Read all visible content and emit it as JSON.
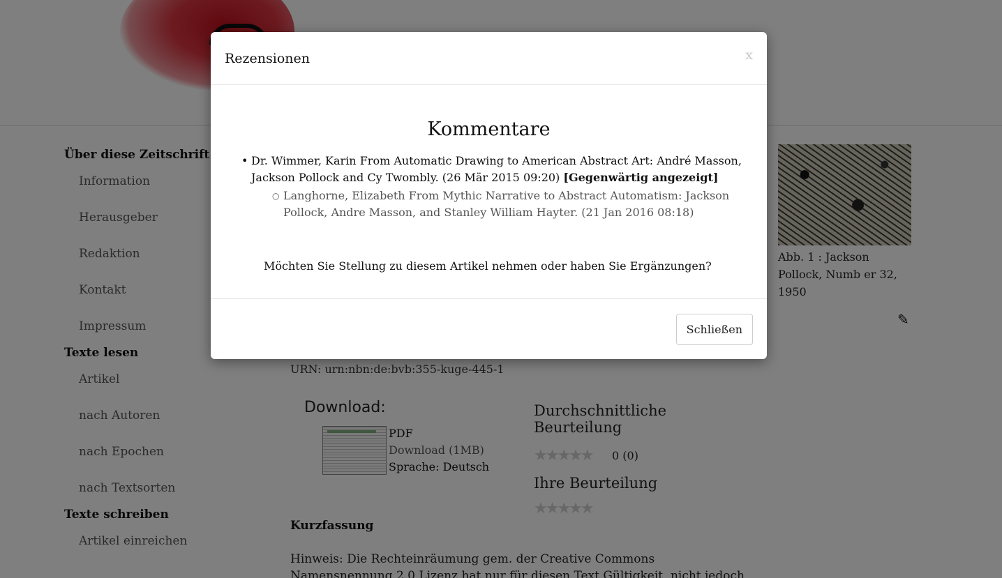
{
  "sidebar": {
    "sections": [
      {
        "heading": "Über diese Zeitschrift",
        "items": [
          "Information",
          "Herausgeber",
          "Redaktion",
          "Kontakt",
          "Impressum"
        ]
      },
      {
        "heading": "Texte lesen",
        "items": [
          "Artikel",
          "nach Autoren",
          "nach Epochen",
          "nach Textsorten"
        ]
      },
      {
        "heading": "Texte schreiben",
        "items": [
          "Artikel einreichen"
        ]
      }
    ]
  },
  "figure": {
    "caption": "Abb. 1 : Jackson Pollock, Numb er 32, 1950",
    "edit_icon": "pencil-icon"
  },
  "article": {
    "urn": "URN: urn:nbn:de:bvb:355-kuge-445-1",
    "download_heading": "Download:",
    "pdf_label": "PDF",
    "pdf_link": "Download (1MB)",
    "pdf_language": "Sprache: Deutsch",
    "rating_avg_heading": "Durchschnittliche Beurteilung",
    "rating_avg_value": 0,
    "rating_avg_text": "0 (0)",
    "rating_your_heading": "Ihre Beurteilung",
    "stars_glyphs": "★★★★★",
    "abstract_heading": "Kurzfassung",
    "abstract_text": "Hinweis: Die Rechteinräumung gem. der Creative Commons Namensnennung 2.0 Lizenz hat nur für diesen Text Gültigkeit, nicht jedoch für die darin"
  },
  "modal": {
    "title": "Rezensionen",
    "close_x": "x",
    "heading": "Kommentare",
    "comment_main": "Dr. Wimmer, Karin From Automatic Drawing to American Abstract Art: André Masson, Jackson Pollock and Cy Twombly. (26 Mär 2015 09:20) ",
    "comment_main_current": "[Gegenwärtig angezeigt]",
    "comment_reply": "Langhorne, Elizabeth From Mythic Narrative to Abstract Automatism: Jackson Pollock, Andre Masson, and Stanley William Hayter. (21 Jan 2016 08:18)",
    "question": "Möchten Sie Stellung zu diesem Artikel nehmen oder haben Sie Ergänzungen?",
    "close_button": "Schließen"
  },
  "colors": {
    "overlay": "#000000",
    "modal_bg": "#ffffff",
    "logo_red": "#c1121f"
  }
}
